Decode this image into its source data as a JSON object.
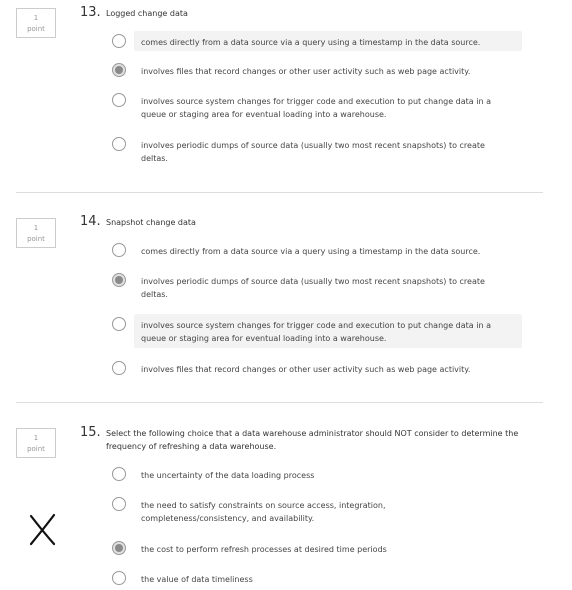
{
  "questions": [
    {
      "number": "13.",
      "points_value": "1",
      "points_label": "point",
      "text": "Logged change data",
      "options": [
        {
          "text": "comes directly from a data source via a query using a timestamp in the data source.",
          "selected": false
        },
        {
          "text": "involves files that record changes or other user activity such as web page activity.",
          "selected": true
        },
        {
          "text": "involves source system changes for trigger code and execution to put change data in a queue or staging area for eventual loading into a warehouse.",
          "selected": false
        },
        {
          "text": "involves periodic dumps of source data (usually two most recent snapshots) to create deltas.",
          "selected": false
        }
      ]
    },
    {
      "number": "14.",
      "points_value": "1",
      "points_label": "point",
      "text": "Snapshot change data",
      "options": [
        {
          "text": "comes directly from a data source via a query using a timestamp in the data source.",
          "selected": false
        },
        {
          "text": "involves periodic dumps of source data (usually two most recent snapshots) to create deltas.",
          "selected": true
        },
        {
          "text": "involves source system changes for trigger code and execution to put change data in a queue or staging area for eventual loading into a warehouse.",
          "selected": false
        },
        {
          "text": "involves files that record changes or other user activity such as web page activity.",
          "selected": false
        }
      ]
    },
    {
      "number": "15.",
      "points_value": "1",
      "points_label": "point",
      "text": "Select the following choice that a data warehouse administrator should NOT consider to determine the frequency of refreshing a data warehouse.",
      "options": [
        {
          "text": "the uncertainty of the data loading process",
          "selected": false
        },
        {
          "text": "the need to satisfy constraints on source access, integration, completeness/consistency, and availability.",
          "selected": false
        },
        {
          "text": "the cost to perform refresh processes at desired time periods",
          "selected": true
        },
        {
          "text": "the value of data timeliness",
          "selected": false
        }
      ]
    }
  ],
  "annotations": {
    "x_mark_icon": "handwritten-x-mark-icon"
  }
}
